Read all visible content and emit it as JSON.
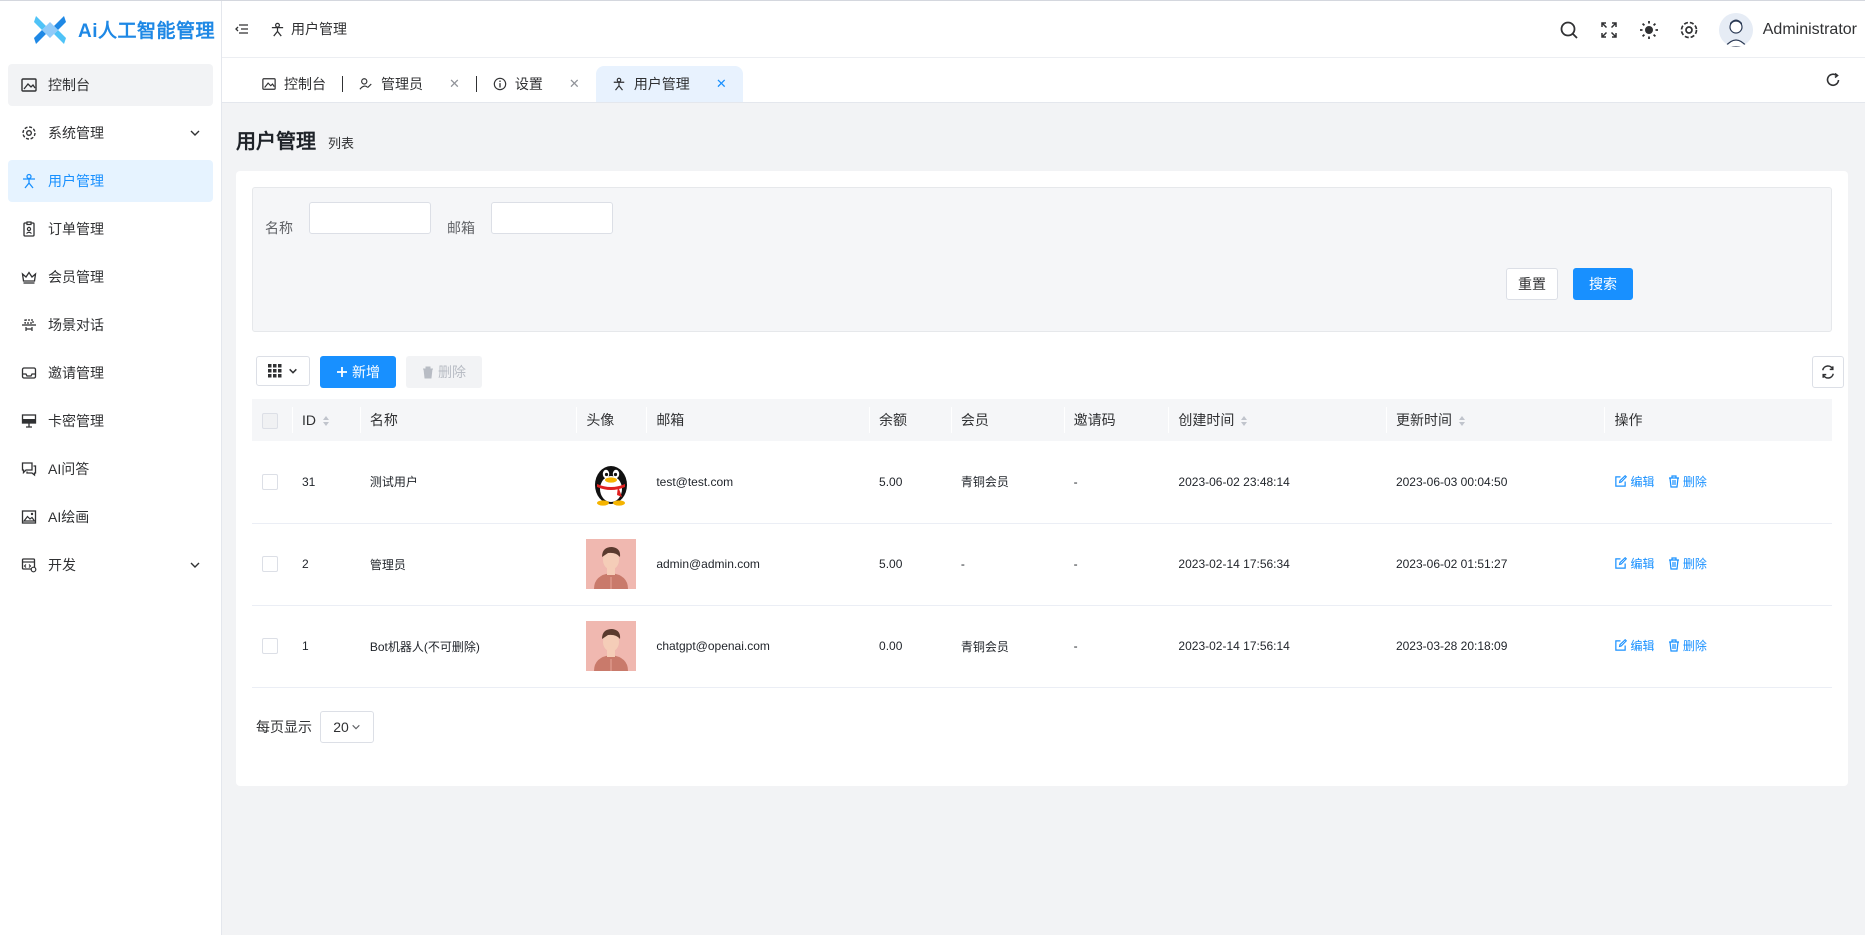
{
  "app": {
    "title": "Ai人工智能管理"
  },
  "sidebar": {
    "items": [
      {
        "label": "控制台",
        "icon": "image-icon"
      },
      {
        "label": "系统管理",
        "icon": "gear-icon"
      },
      {
        "label": "用户管理",
        "icon": "user-icon"
      },
      {
        "label": "订单管理",
        "icon": "clipboard-icon"
      },
      {
        "label": "会员管理",
        "icon": "crown-icon"
      },
      {
        "label": "场景对话",
        "icon": "scene-icon"
      },
      {
        "label": "邀请管理",
        "icon": "inbox-icon"
      },
      {
        "label": "卡密管理",
        "icon": "monitor-icon"
      },
      {
        "label": "AI问答",
        "icon": "chat-icon"
      },
      {
        "label": "AI绘画",
        "icon": "picture-icon"
      },
      {
        "label": "开发",
        "icon": "dev-icon"
      }
    ]
  },
  "header": {
    "breadcrumb": "用户管理",
    "user_name": "Administrator"
  },
  "tabs": [
    {
      "label": "控制台"
    },
    {
      "label": "管理员"
    },
    {
      "label": "设置"
    },
    {
      "label": "用户管理"
    }
  ],
  "page": {
    "title": "用户管理",
    "subtitle": "列表"
  },
  "search": {
    "name_label": "名称",
    "name_value": "",
    "email_label": "邮箱",
    "email_value": "",
    "reset_label": "重置",
    "search_label": "搜索"
  },
  "toolbar": {
    "add_label": "新增",
    "delete_label": "删除"
  },
  "table": {
    "columns": {
      "id": "ID",
      "name": "名称",
      "avatar": "头像",
      "email": "邮箱",
      "balance": "余额",
      "member": "会员",
      "invite": "邀请码",
      "created": "创建时间",
      "updated": "更新时间",
      "ops": "操作"
    },
    "rows": [
      {
        "id": "31",
        "name": "测试用户",
        "avatar": "qq-penguin",
        "email": "test@test.com",
        "balance": "5.00",
        "member": "青铜会员",
        "invite": "-",
        "created": "2023-06-02 23:48:14",
        "updated": "2023-06-03 00:04:50"
      },
      {
        "id": "2",
        "name": "管理员",
        "avatar": "person",
        "email": "admin@admin.com",
        "balance": "5.00",
        "member": "-",
        "invite": "-",
        "created": "2023-02-14 17:56:34",
        "updated": "2023-06-02 01:51:27"
      },
      {
        "id": "1",
        "name": "Bot机器人(不可删除)",
        "avatar": "person",
        "email": "chatgpt@openai.com",
        "balance": "0.00",
        "member": "青铜会员",
        "invite": "-",
        "created": "2023-02-14 17:56:14",
        "updated": "2023-03-28 20:18:09"
      }
    ],
    "edit_label": "编辑",
    "delete_label": "删除"
  },
  "pager": {
    "per_page_label": "每页显示",
    "per_page_value": "20"
  },
  "colors": {
    "primary": "#1890ff",
    "logo": "#1e88e5",
    "active_bg": "#e6f3ff"
  }
}
